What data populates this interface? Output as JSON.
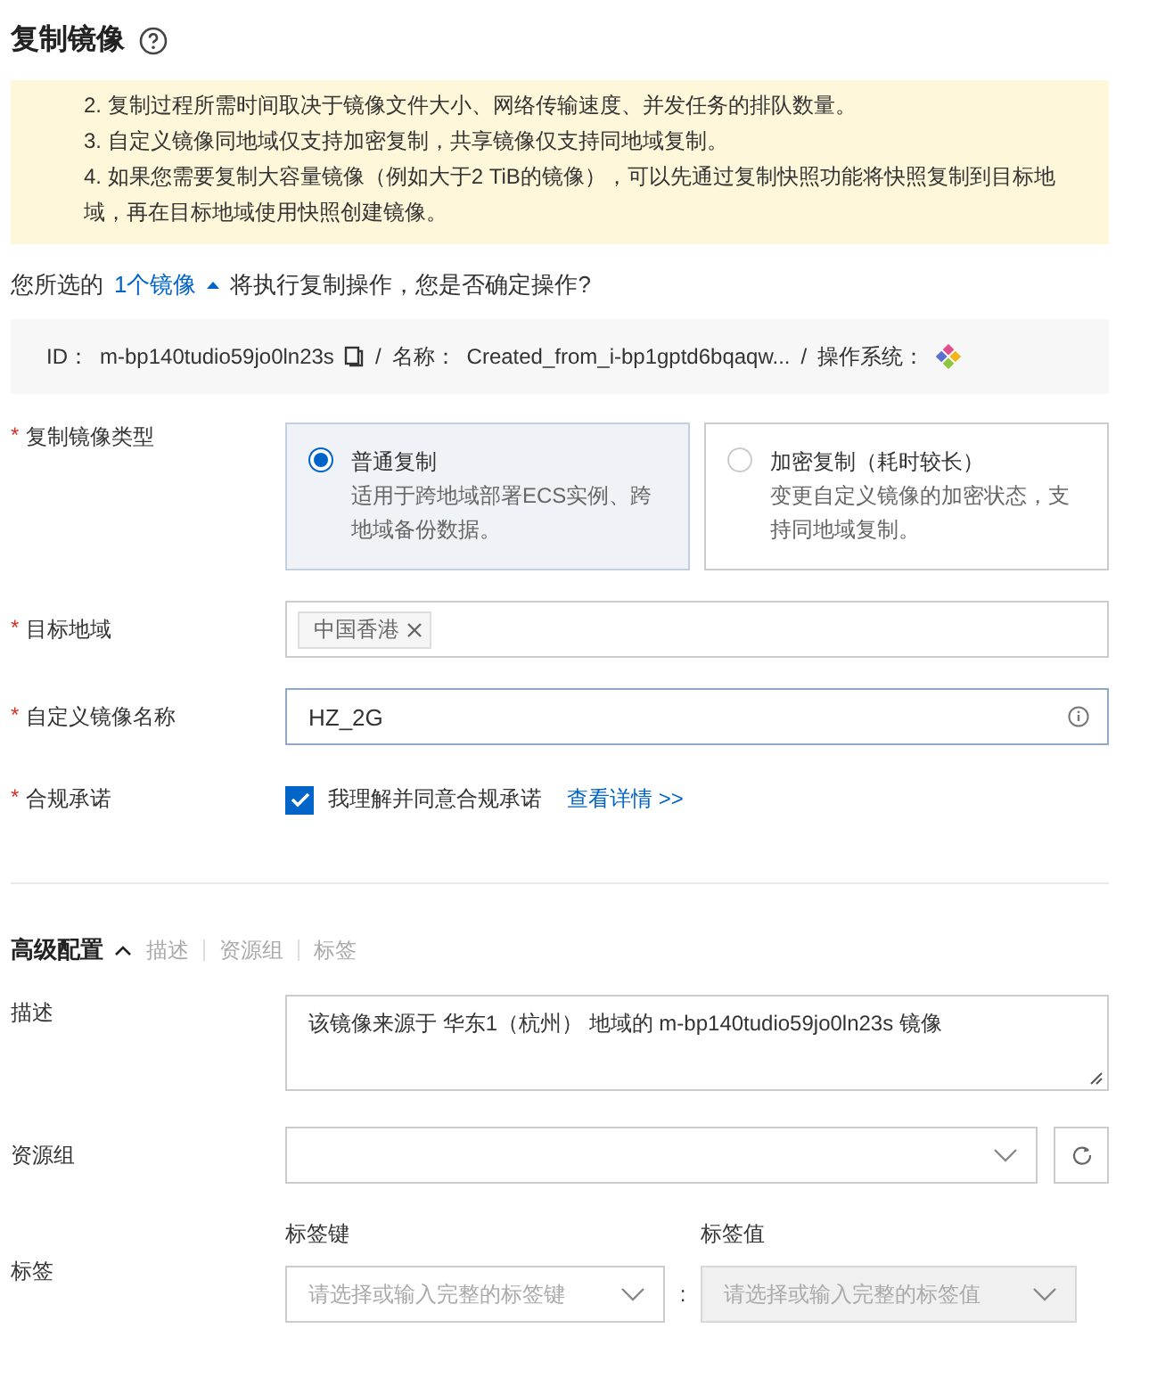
{
  "title": "复制镜像",
  "alert": {
    "lines": [
      "2. 复制过程所需时间取决于镜像文件大小、网络传输速度、并发任务的排队数量。",
      "3. 自定义镜像同地域仅支持加密复制，共享镜像仅支持同地域复制。",
      "4. 如果您需要复制大容量镜像（例如大于2 TiB的镜像），可以先通过复制快照功能将快照复制到目标地域，再在目标地域使用快照创建镜像。"
    ]
  },
  "selection": {
    "prefix": "您所选的",
    "link": "1个镜像",
    "suffix": "将执行复制操作，您是否确定操作?",
    "expanded": true
  },
  "image_info": {
    "id_label": "ID：",
    "id": "m-bp140tudio59jo0ln23s",
    "name_label": "名称：",
    "name": "Created_from_i-bp1gptd6bqaqw...",
    "os_label": "操作系统：",
    "separators": [
      "/",
      "/"
    ]
  },
  "copy_type": {
    "mark": "*",
    "label": "复制镜像类型",
    "options": [
      {
        "title": "普通复制",
        "desc": "适用于跨地域部署ECS实例、跨地域备份数据。",
        "selected": true
      },
      {
        "title": "加密复制（耗时较长）",
        "desc": "变更自定义镜像的加密状态，支持同地域复制。",
        "selected": false
      }
    ]
  },
  "target_region": {
    "mark": "*",
    "label": "目标地域",
    "tags": [
      "中国香港"
    ]
  },
  "image_name": {
    "mark": "*",
    "label": "自定义镜像名称",
    "value": "HZ_2G"
  },
  "compliance": {
    "mark": "*",
    "label": "合规承诺",
    "checkbox": "我理解并同意合规承诺",
    "checked": true,
    "link": "查看详情 >>"
  },
  "advanced": {
    "title": "高级配置",
    "expanded": true,
    "sections": [
      "描述",
      "资源组",
      "标签"
    ]
  },
  "description": {
    "label": "描述",
    "value": "该镜像来源于 华东1（杭州） 地域的 m-bp140tudio59jo0ln23s 镜像"
  },
  "resource_group": {
    "label": "资源组"
  },
  "tags": {
    "label": "标签",
    "key_label": "标签键",
    "key_placeholder": "请选择或输入完整的标签键",
    "separator": ":",
    "value_label": "标签值",
    "value_placeholder": "请选择或输入完整的标签值",
    "value_disabled": true
  }
}
